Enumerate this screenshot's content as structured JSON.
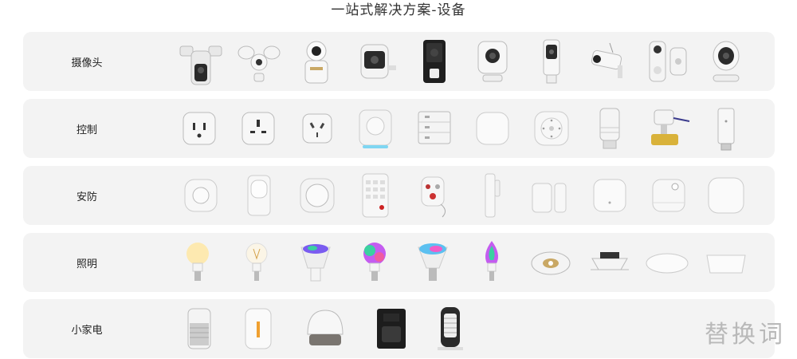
{
  "page": {
    "title": "一站式解决方案-设备",
    "watermark": "替换词"
  },
  "categories": [
    {
      "label": "摄像头",
      "devices": [
        "floodlight-camera",
        "floodlight-camera-white",
        "pan-tilt-camera",
        "battery-outdoor-camera",
        "doorbell-camera",
        "indoor-cube-camera",
        "indoor-slim-camera",
        "bullet-camera",
        "video-doorbell-with-chime",
        "indoor-round-camera"
      ]
    },
    {
      "label": "控制",
      "devices": [
        "us-smart-plug",
        "uk-smart-plug",
        "au-smart-plug",
        "dimmer-knob",
        "scene-switch-panel",
        "smart-hub",
        "remote-button",
        "radiator-thermostat-valve",
        "water-valve-controller",
        "usb-gateway"
      ]
    },
    {
      "label": "安防",
      "devices": [
        "round-motion-sensor",
        "pir-motion-sensor",
        "smart-button",
        "keypad",
        "panic-remote",
        "door-window-sensor",
        "contact-sensor",
        "gateway-hub",
        "water-leak-sensor",
        "sensor-pad"
      ]
    },
    {
      "label": "照明",
      "devices": [
        "a19-bulb",
        "filament-bulb",
        "gu10-rgb-bulb",
        "rgb-bulb",
        "br30-rgb-bulb",
        "candle-rgb-bulb",
        "recessed-spotlight",
        "downlight",
        "ceiling-light",
        "panel-light"
      ]
    },
    {
      "label": "小家电",
      "devices": [
        "air-purifier",
        "humidifier",
        "aroma-diffuser",
        "coffee-maker",
        "space-heater"
      ]
    }
  ]
}
